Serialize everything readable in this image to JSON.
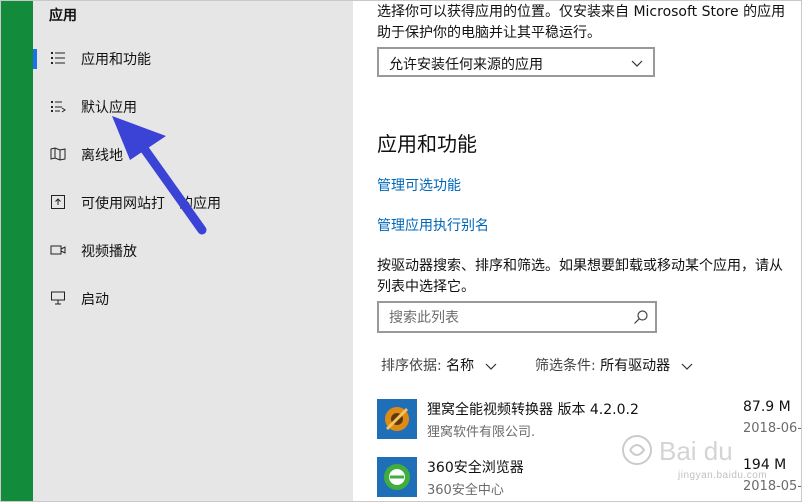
{
  "sidebar": {
    "title": "应用",
    "items": [
      {
        "label": "应用和功能",
        "icon": "list-icon"
      },
      {
        "label": "默认应用",
        "icon": "default-apps-icon"
      },
      {
        "label": "离线地",
        "icon": "offline-map-icon"
      },
      {
        "label": "可使用网站打",
        "label2": "的应用",
        "icon": "open-with-icon"
      },
      {
        "label": "视频播放",
        "icon": "video-icon"
      },
      {
        "label": "启动",
        "icon": "startup-icon"
      }
    ]
  },
  "main": {
    "desc_line1": "选择你可以获得应用的位置。仅安装来自 Microsoft Store 的应用",
    "desc_line2": "助于保护你的电脑并让其平稳运行。",
    "install_source_value": "允许安装任何来源的应用",
    "section_title": "应用和功能",
    "link_optional_features": "管理可选功能",
    "link_app_alias": "管理应用执行别名",
    "search_desc_line1": "按驱动器搜索、排序和筛选。如果想要卸载或移动某个应用，请从",
    "search_desc_line2": "列表中选择它。",
    "search_placeholder": "搜索此列表",
    "sort_label": "排序依据:",
    "sort_value": "名称",
    "filter_label": "筛选条件:",
    "filter_value": "所有驱动器",
    "apps": [
      {
        "name": "狸窝全能视频转换器 版本  4.2.0.2",
        "publisher": "狸窝软件有限公司.",
        "size": "87.9 M",
        "date": "2018-06-"
      },
      {
        "name": "360安全浏览器",
        "publisher": "360安全中心",
        "size": "194 M",
        "date": "2018-05-"
      }
    ]
  },
  "watermark": {
    "text": "jingyan.baidu.com"
  },
  "colors": {
    "accent": "#0067b8",
    "green_strip": "#128b3a",
    "arrow": "#3a43d6"
  }
}
